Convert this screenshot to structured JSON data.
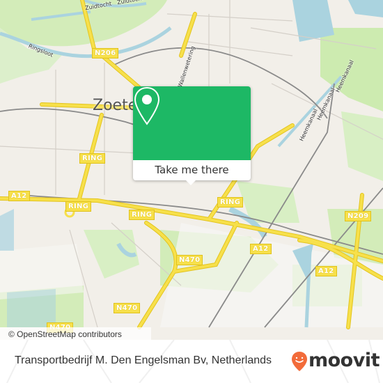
{
  "map": {
    "city_label": "Zoete",
    "road_labels": [
      "N206",
      "RING",
      "RING",
      "RING",
      "RING",
      "A12",
      "A12",
      "A12",
      "N470",
      "N470",
      "N470",
      "N209"
    ],
    "street_labels": [
      "Zuidtocht",
      "Zuidtocht",
      "Ringsloot",
      "e Wallenwetering",
      "Heemkanaal",
      "Heemkanaal",
      "Heemkanaal"
    ],
    "attribution": "© OpenStreetMap contributors",
    "colors": {
      "land": "#f2efe9",
      "park": "#cdebb0",
      "water": "#aad3df",
      "major_road": "#f7e04b",
      "rail": "#888888"
    }
  },
  "popup": {
    "button_label": "Take me there",
    "icon": "map-pin-icon",
    "accent_color": "#1db865"
  },
  "footer": {
    "title": "Transportbedrijf M. Den Engelsman Bv, Netherlands",
    "brand": "moovit",
    "brand_icon": "moovit-smiley-pin-icon",
    "brand_color": "#f26b3a"
  }
}
